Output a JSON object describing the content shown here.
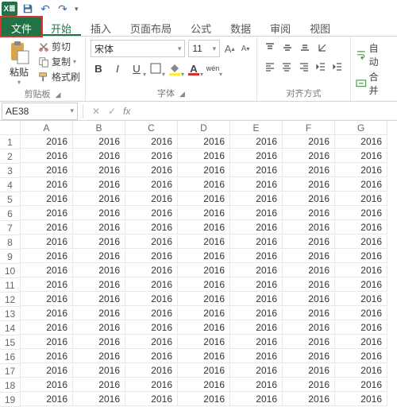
{
  "qat": {
    "undo": "↶"
  },
  "tabs": {
    "file": "文件",
    "home": "开始",
    "insert": "插入",
    "layout": "页面布局",
    "formulas": "公式",
    "data": "数据",
    "review": "审阅",
    "view": "视图"
  },
  "ribbon": {
    "clipboard": {
      "paste": "粘贴",
      "cut": "剪切",
      "copy": "复制",
      "format_painter": "格式刷",
      "group": "剪贴板"
    },
    "font": {
      "name": "宋体",
      "size": "11",
      "bold": "B",
      "italic": "I",
      "underline": "U",
      "phonetic": "wén",
      "group": "字体",
      "grow": "A",
      "shrink": "A"
    },
    "align": {
      "group": "对齐方式"
    },
    "extra": {
      "wrap": "自动",
      "merge": "合并"
    }
  },
  "fx": {
    "namebox": "AE38",
    "cancel": "✕",
    "enter": "✓",
    "fx": "fx",
    "value": ""
  },
  "grid": {
    "columns": [
      "A",
      "B",
      "C",
      "D",
      "E",
      "F",
      "G"
    ],
    "rows": [
      "1",
      "2",
      "3",
      "4",
      "5",
      "6",
      "7",
      "8",
      "9",
      "10",
      "11",
      "12",
      "13",
      "14",
      "15",
      "16",
      "17",
      "18",
      "19"
    ],
    "cell_value": "2016"
  },
  "chart_data": {
    "type": "table",
    "columns": [
      "A",
      "B",
      "C",
      "D",
      "E",
      "F",
      "G"
    ],
    "rows": 19,
    "uniform_value": 2016,
    "title": "",
    "note": "All visible cells A1:G19 contain 2016"
  }
}
